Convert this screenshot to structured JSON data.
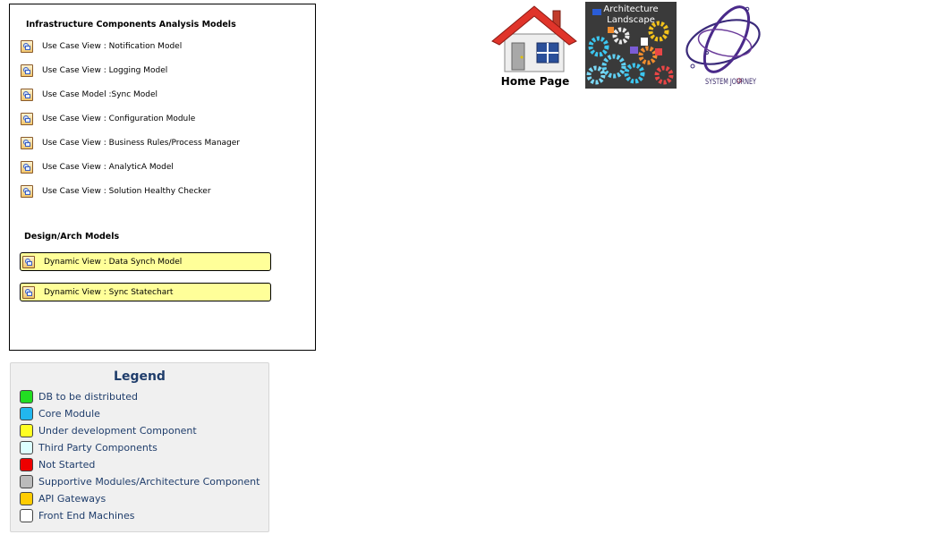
{
  "panel": {
    "infra_title": "Infrastructure Components Analysis Models",
    "infra_items": [
      "Use Case View : Notification Model",
      "Use Case View : Logging Model",
      "Use Case Model :Sync Model",
      "Use Case View : Configuration Module",
      "Use Case View : Business Rules/Process Manager",
      "Use Case View : AnalyticA Model",
      "Use Case View : Solution Healthy Checker"
    ],
    "design_title": "Design/Arch Models",
    "design_items": [
      "Dynamic View : Data Synch Model",
      "Dynamic View : Sync Statechart"
    ]
  },
  "legend": {
    "title": "Legend",
    "items": [
      {
        "label": "DB to be distributed",
        "color": "#22dd22"
      },
      {
        "label": "Core Module",
        "color": "#22b7ee"
      },
      {
        "label": "Under development Component",
        "color": "#ffff22"
      },
      {
        "label": "Third Party Components",
        "color": "#ddffff"
      },
      {
        "label": "Not Started",
        "color": "#ee0000"
      },
      {
        "label": "Supportive Modules/Architecture Component",
        "color": "#bbbbbb"
      },
      {
        "label": "API Gateways",
        "color": "#ffcc00"
      },
      {
        "label": "Front End Machines",
        "color": "#ffffff"
      }
    ]
  },
  "nav": {
    "home_label": "Home Page",
    "arch_label": "Architecture\nLandscape",
    "journey_label": "SYSTEM JOURNEY"
  },
  "icons": {
    "model_item": "model-diagram-icon",
    "home": "house-icon",
    "arch": "gears-collage-icon",
    "journey": "orbit-logo-icon"
  }
}
